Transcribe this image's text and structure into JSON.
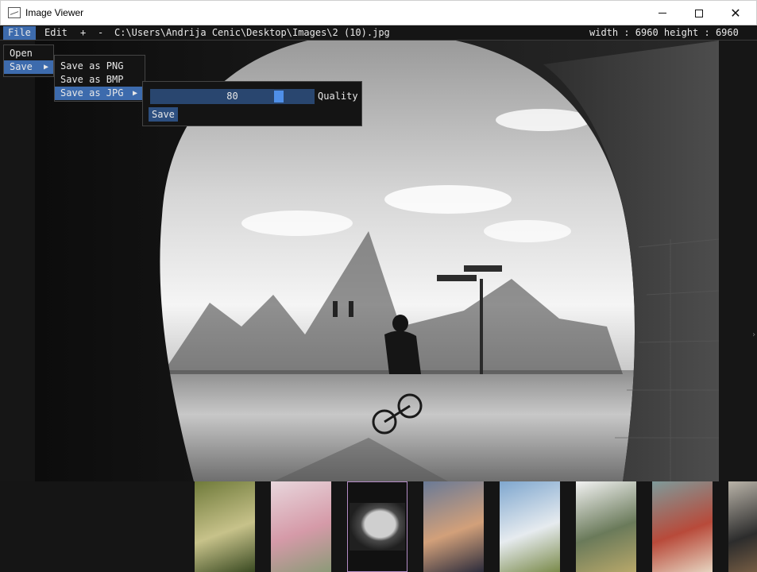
{
  "window": {
    "title": "Image Viewer",
    "icons": {
      "app": "image-app-icon",
      "minimize": "minimize-icon",
      "maximize": "maximize-icon",
      "close": "close-icon"
    },
    "close_glyph": "✕"
  },
  "menubar": {
    "file": "File",
    "edit": "Edit",
    "zoom_in": "+",
    "zoom_out": "-",
    "path": "C:\\Users\\Andrija Cenic\\Desktop\\Images\\2 (10).jpg",
    "dimensions": "width : 6960 height : 6960"
  },
  "file_menu": {
    "items": [
      {
        "label": "Open"
      },
      {
        "label": "Save",
        "arrow": "▶"
      }
    ]
  },
  "save_menu": {
    "items": [
      {
        "label": "Save as PNG"
      },
      {
        "label": "Save as BMP"
      },
      {
        "label": "Save as JPG",
        "arrow": "▶"
      }
    ]
  },
  "jpg_menu": {
    "quality_value": "80",
    "quality_fraction": 0.8,
    "quality_label": "Quality",
    "save_label": "Save"
  },
  "colors": {
    "accent": "#3d6bad",
    "slider_bg": "#29466f",
    "slider_grab": "#4f8fe8",
    "selected_thumb_border": "#b48cc6"
  },
  "thumbnails": [
    {
      "subject": "hummingbird",
      "colors": [
        "#6f7a3a",
        "#c7c28a",
        "#3a4a22"
      ],
      "selected": false
    },
    {
      "subject": "pink roses",
      "colors": [
        "#e8d6dc",
        "#d59aa8",
        "#8c9a78"
      ],
      "selected": false
    },
    {
      "subject": "tunnel cyclist",
      "colors": [
        "#202020",
        "#cfcfcf",
        "#4a4a4a"
      ],
      "selected": true
    },
    {
      "subject": "sunset lake",
      "colors": [
        "#6a7a96",
        "#d2a07a",
        "#2c2c3c"
      ],
      "selected": false
    },
    {
      "subject": "palm trees",
      "colors": [
        "#7fa7cf",
        "#e6ebef",
        "#7a8a4a"
      ],
      "selected": false
    },
    {
      "subject": "stone arch",
      "colors": [
        "#f2f2f2",
        "#6a7a5a",
        "#b8a86a"
      ],
      "selected": false
    },
    {
      "subject": "hands with candle",
      "colors": [
        "#7e9a9a",
        "#b84a3a",
        "#e6d4c0"
      ],
      "selected": false
    },
    {
      "subject": "table still life",
      "colors": [
        "#b9b3a8",
        "#2c2c2c",
        "#8a6a4a"
      ],
      "selected": false
    }
  ]
}
